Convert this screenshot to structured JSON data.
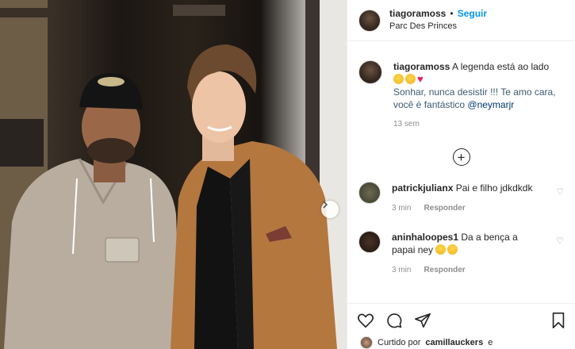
{
  "post": {
    "username": "tiagoramoss",
    "separator": "•",
    "follow_label": "Seguir",
    "location": "Parc Des Princes",
    "next_icon": "chevron-right-icon"
  },
  "caption": {
    "username": "tiagoramoss",
    "line1": "A legenda está ao lado",
    "line2": "Sonhar, nunca desistir !!! Te amo cara, você é fantástico",
    "mention": "@neymarjr",
    "time": "13 sem"
  },
  "comments": [
    {
      "username": "patrickjulianx",
      "text": "Pai e filho jdkdkdk",
      "time": "3 min",
      "reply": "Responder"
    },
    {
      "username": "aninhaloopes1",
      "text": "Da a bença a papai ney",
      "time": "3 min",
      "reply": "Responder"
    }
  ],
  "liked_by": {
    "prefix": "Curtido por",
    "user": "camillauckers",
    "suffix": "e"
  },
  "icons": [
    "heart-icon",
    "comment-icon",
    "share-icon",
    "save-icon",
    "add-comment-icon"
  ],
  "colors": {
    "link": "#0095f6",
    "mention": "#00376b",
    "text": "#262626",
    "muted": "#8e8e8e"
  }
}
